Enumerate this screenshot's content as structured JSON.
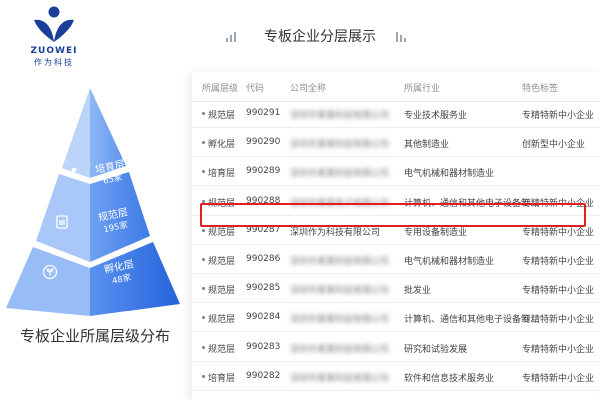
{
  "brand": {
    "name_en": "ZUOWEI",
    "name_cn": "作为科技",
    "logo_color": "#1b3f99"
  },
  "header": {
    "title": "专板企业分层展示"
  },
  "pyramid": {
    "caption": "专板企业所属层级分布",
    "tiers": [
      {
        "name": "培育层",
        "count": "65家",
        "icon": "hand-heart-icon",
        "color": "#6fa0f0"
      },
      {
        "name": "规范层",
        "count": "195家",
        "icon": "document-icon",
        "color": "#4a86ea"
      },
      {
        "name": "孵化层",
        "count": "48家",
        "icon": "sprout-icon",
        "color": "#2f6fe0"
      }
    ]
  },
  "table": {
    "headers": [
      "所属层级",
      "代码",
      "公司全称",
      "所属行业",
      "特色标签"
    ],
    "rows": [
      {
        "level": "规范层",
        "code": "990291",
        "company": "深圳市某某科技有限公司",
        "industry": "专业技术服务业",
        "tag": "专精特新中小企业",
        "blurred": true
      },
      {
        "level": "孵化层",
        "code": "990290",
        "company": "深圳市某某科技有限公司",
        "industry": "其他制造业",
        "tag": "创新型中小企业",
        "blurred": true
      },
      {
        "level": "培育层",
        "code": "990289",
        "company": "深圳市某某科技有限公司",
        "industry": "电气机械和器材制造业",
        "tag": "",
        "blurred": true
      },
      {
        "level": "规范层",
        "code": "990288",
        "company": "深圳市某某电子有限公司",
        "industry": "计算机、通信和其他电子设备制...",
        "tag": "专精特新中小企业",
        "blurred": true
      },
      {
        "level": "规范层",
        "code": "990287",
        "company": "深圳作为科技有限公司",
        "industry": "专用设备制造业",
        "tag": "专精特新中小企业",
        "blurred": false
      },
      {
        "level": "规范层",
        "code": "990286",
        "company": "深圳市某某科技有限公司",
        "industry": "电气机械和器材制造业",
        "tag": "专精特新中小企业",
        "blurred": true
      },
      {
        "level": "规范层",
        "code": "990285",
        "company": "深圳市某某科技有限公司",
        "industry": "批发业",
        "tag": "专精特新中小企业",
        "blurred": true
      },
      {
        "level": "规范层",
        "code": "990284",
        "company": "深圳市某某科技有限公司",
        "industry": "计算机、通信和其他电子设备制...",
        "tag": "专精特新中小企业",
        "blurred": true
      },
      {
        "level": "规范层",
        "code": "990283",
        "company": "深圳市某某科技有限公司",
        "industry": "研究和试验发展",
        "tag": "专精特新中小企业",
        "blurred": true
      },
      {
        "level": "培育层",
        "code": "990282",
        "company": "深圳市某某科技有限公司",
        "industry": "软件和信息技术服务业",
        "tag": "专精特新中小企业",
        "blurred": true
      }
    ]
  }
}
